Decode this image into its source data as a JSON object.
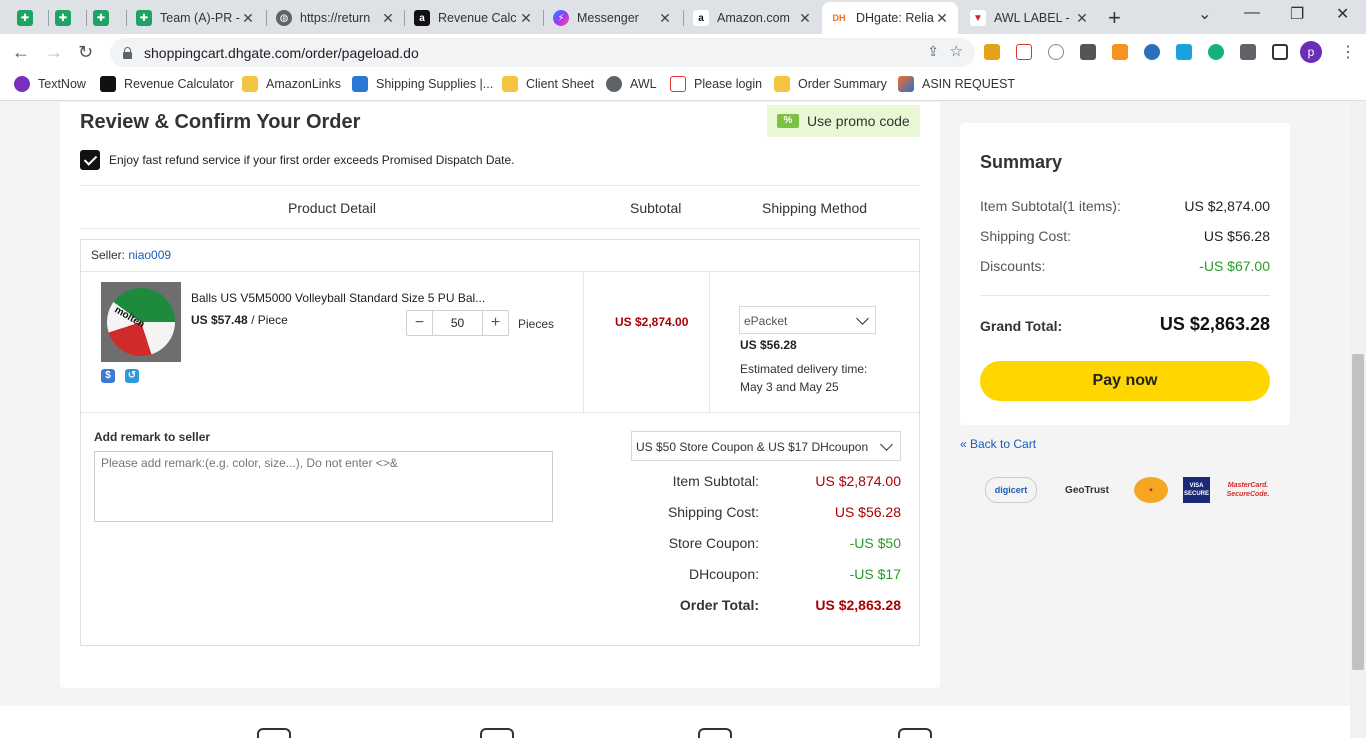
{
  "browser": {
    "tabs": [
      {
        "label": "",
        "icon": "sheets-icon"
      },
      {
        "label": "",
        "icon": "sheets-icon"
      },
      {
        "label": "",
        "icon": "sheets-icon"
      },
      {
        "label": "Team (A)-PR -",
        "icon": "sheets-icon"
      },
      {
        "label": "https://return",
        "icon": "globe-icon"
      },
      {
        "label": "Revenue Calc",
        "icon": "amazon-icon"
      },
      {
        "label": "Messenger",
        "icon": "messenger-icon"
      },
      {
        "label": "Amazon.com",
        "icon": "amazon-icon"
      },
      {
        "label": "DHgate: Relia",
        "icon": "dhgate-icon",
        "active": true
      },
      {
        "label": "AWL LABEL -",
        "icon": "awl-icon"
      }
    ],
    "url": "shoppingcart.dhgate.com/order/pageload.do",
    "profile_initial": "p",
    "bookmarks": [
      "TextNow",
      "Revenue Calculator",
      "AmazonLinks",
      "Shipping Supplies |...",
      "Client Sheet",
      "AWL",
      "Please login",
      "Order Summary",
      "ASIN REQUEST"
    ]
  },
  "order": {
    "title": "Review & Confirm Your Order",
    "promo_label": "Use promo code",
    "promo_badge": "%",
    "refund_text": "Enjoy fast refund service if your first order exceeds Promised Dispatch Date.",
    "refund_checked": true,
    "headers": {
      "product": "Product Detail",
      "subtotal": "Subtotal",
      "shipping": "Shipping Method"
    },
    "seller_label": "Seller:",
    "seller_name": "niao009",
    "product": {
      "name": "Balls US V5M5000 Volleyball Standard Size 5 PU Bal...",
      "price": "US $57.48",
      "unit": "/ Piece",
      "image_text": "molten",
      "quantity": "50",
      "qty_unit": "Pieces",
      "subtotal": "US $2,874.00"
    },
    "shipping": {
      "method": "ePacket",
      "cost": "US $56.28",
      "delivery_label": "Estimated delivery time:",
      "delivery_dates": "May 3 and May 25"
    },
    "remark_label": "Add remark to seller",
    "remark_placeholder": "Please add remark:(e.g. color, size...), Do not enter <>&",
    "coupon_select": "US $50 Store Coupon & US $17 DHcoupon",
    "totals": {
      "item_subtotal_label": "Item Subtotal:",
      "item_subtotal": "US $2,874.00",
      "shipping_label": "Shipping Cost:",
      "shipping": "US $56.28",
      "store_coupon_label": "Store Coupon:",
      "store_coupon": "-US $50",
      "dhcoupon_label": "DHcoupon:",
      "dhcoupon": "-US $17",
      "order_total_label": "Order Total:",
      "order_total": "US $2,863.28"
    }
  },
  "summary": {
    "title": "Summary",
    "item_subtotal_label": "Item Subtotal(1 items):",
    "item_subtotal": "US $2,874.00",
    "shipping_label": "Shipping Cost:",
    "shipping": "US $56.28",
    "discounts_label": "Discounts:",
    "discounts": "-US $67.00",
    "grand_total_label": "Grand Total:",
    "grand_total": "US $2,863.28",
    "pay_label": "Pay now",
    "back_label": "« Back to Cart",
    "trust_logos": [
      "digicert",
      "GeoTrust",
      "VISA SECURE",
      "MasterCard. SecureCode."
    ]
  },
  "colors": {
    "accent": "#ffd600",
    "price_red": "#aa0000",
    "discount_green": "#2a9a2a",
    "link": "#1a5cb8"
  }
}
